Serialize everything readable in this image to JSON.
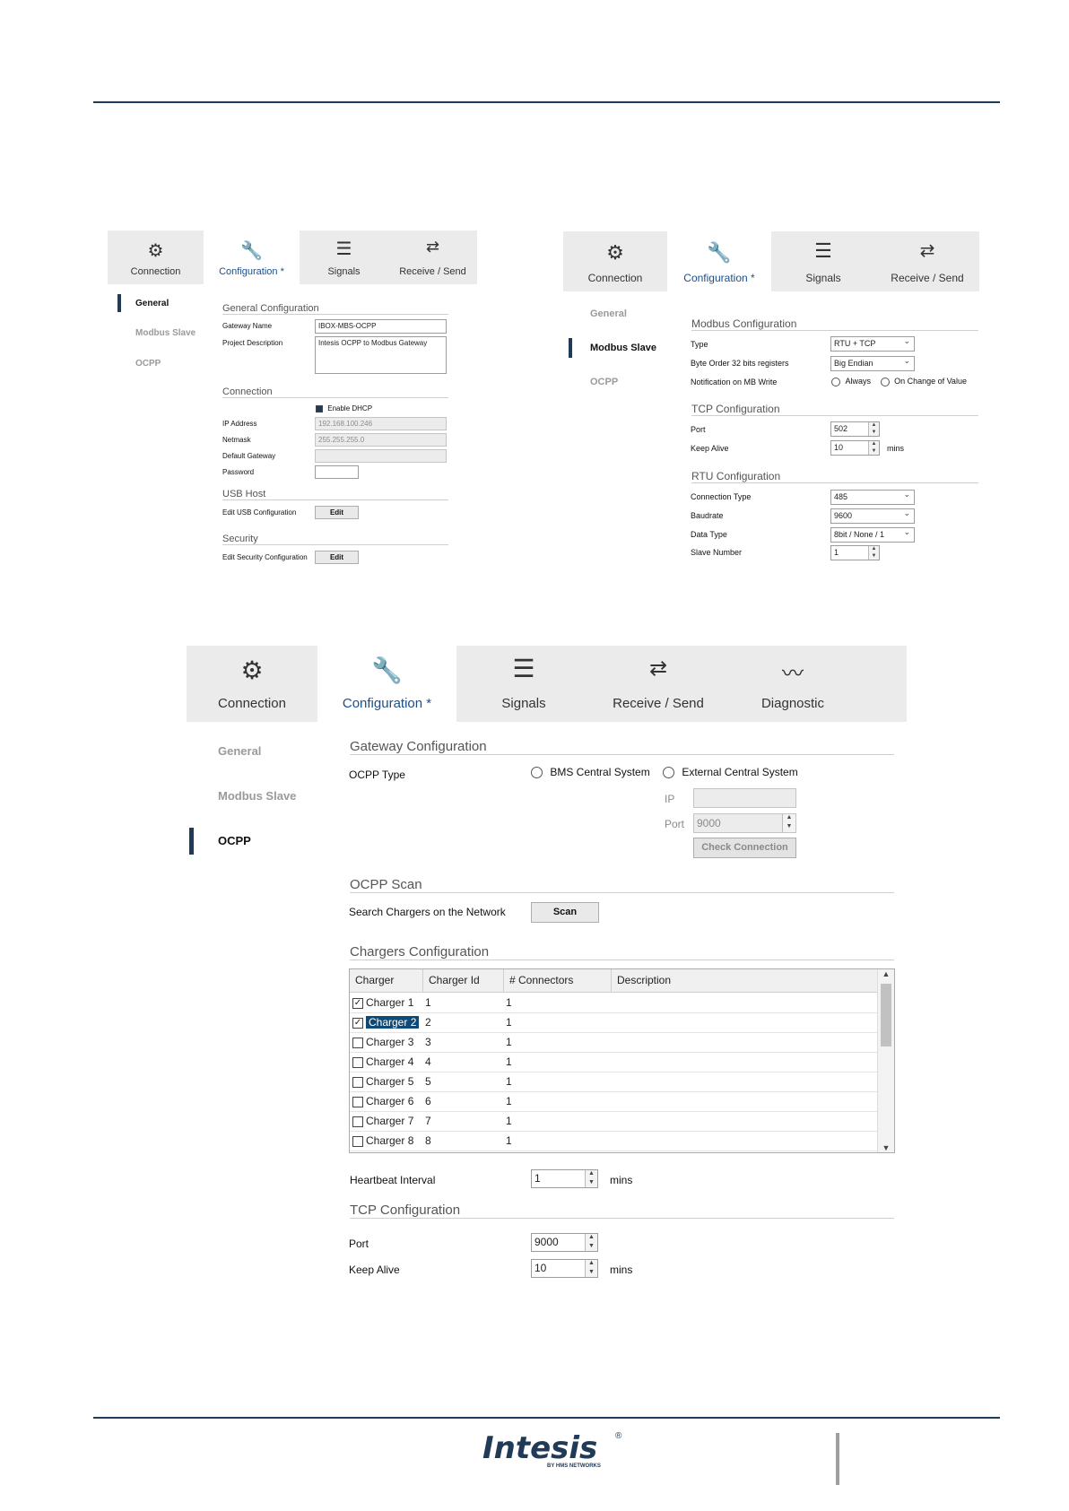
{
  "tabs_small": [
    "Connection",
    "Configuration *",
    "Signals",
    "Receive / Send"
  ],
  "tabs_big": [
    "Connection",
    "Configuration *",
    "Signals",
    "Receive / Send",
    "Diagnostic"
  ],
  "nav": [
    "General",
    "Modbus Slave",
    "OCPP"
  ],
  "general": {
    "sec_general": "General Configuration",
    "gateway_name_label": "Gateway Name",
    "gateway_name_value": "IBOX-MBS-OCPP",
    "project_desc_label": "Project Description",
    "project_desc_value": "Intesis OCPP to Modbus Gateway",
    "sec_connection": "Connection",
    "dhcp_label": "Enable DHCP",
    "ip_label": "IP Address",
    "ip_value": "192.168.100.246",
    "netmask_label": "Netmask",
    "netmask_value": "255.255.255.0",
    "gateway_label": "Default Gateway",
    "password_label": "Password",
    "sec_usb": "USB Host",
    "usb_label": "Edit USB Configuration",
    "sec_security": "Security",
    "security_label": "Edit Security Configuration",
    "edit_button": "Edit"
  },
  "modbus": {
    "sec_modbus": "Modbus Configuration",
    "type_label": "Type",
    "type_value": "RTU + TCP",
    "byte_order_label": "Byte Order 32 bits registers",
    "byte_order_value": "Big Endian",
    "notif_label": "Notification on MB Write",
    "notif_always": "Always",
    "notif_change": "On Change of Value",
    "sec_tcp": "TCP Configuration",
    "port_label": "Port",
    "port_value": "502",
    "keep_alive_label": "Keep Alive",
    "keep_alive_value": "10",
    "mins": "mins",
    "sec_rtu": "RTU Configuration",
    "conn_type_label": "Connection Type",
    "conn_type_value": "485",
    "baudrate_label": "Baudrate",
    "baudrate_value": "9600",
    "data_type_label": "Data Type",
    "data_type_value": "8bit / None / 1",
    "slave_label": "Slave Number",
    "slave_value": "1"
  },
  "ocpp": {
    "sec_gateway": "Gateway Configuration",
    "ocpp_type_label": "OCPP Type",
    "bms_option": "BMS Central System",
    "external_option": "External Central System",
    "ip_label": "IP",
    "port_label": "Port",
    "port_value": "9000",
    "check_button": "Check Connection",
    "sec_scan": "OCPP Scan",
    "search_label": "Search Chargers on the Network",
    "scan_button": "Scan",
    "sec_chargers": "Chargers Configuration",
    "columns": [
      "Charger",
      "Charger Id",
      "# Connectors",
      "Description"
    ],
    "rows": [
      {
        "name": "Charger 1",
        "id": "1",
        "connectors": "1",
        "checked": true
      },
      {
        "name": "Charger 2",
        "id": "2",
        "connectors": "1",
        "checked": true
      },
      {
        "name": "Charger 3",
        "id": "3",
        "connectors": "1",
        "checked": false
      },
      {
        "name": "Charger 4",
        "id": "4",
        "connectors": "1",
        "checked": false
      },
      {
        "name": "Charger 5",
        "id": "5",
        "connectors": "1",
        "checked": false
      },
      {
        "name": "Charger 6",
        "id": "6",
        "connectors": "1",
        "checked": false
      },
      {
        "name": "Charger 7",
        "id": "7",
        "connectors": "1",
        "checked": false
      },
      {
        "name": "Charger 8",
        "id": "8",
        "connectors": "1",
        "checked": false
      }
    ],
    "heartbeat_label": "Heartbeat Interval",
    "heartbeat_value": "1",
    "mins": "mins",
    "sec_tcp": "TCP Configuration",
    "tcp_port_label": "Port",
    "tcp_port_value": "9000",
    "keep_alive_label": "Keep Alive",
    "keep_alive_value": "10"
  },
  "footer": {
    "logo_text": "Intesis",
    "logo_sub": "BY HMS NETWORKS"
  }
}
